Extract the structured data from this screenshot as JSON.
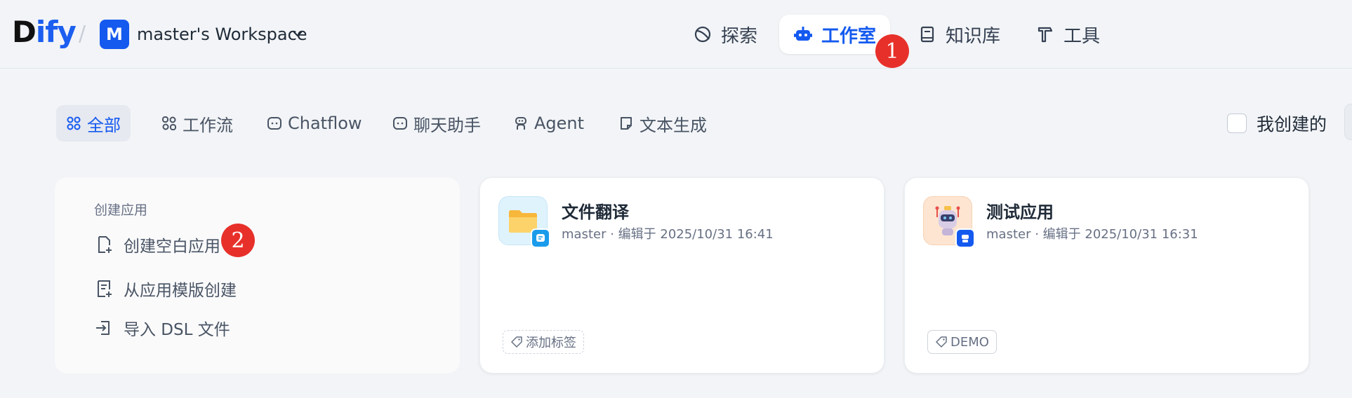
{
  "header": {
    "logo": {
      "part1": "D",
      "part2": "ify"
    },
    "workspace": {
      "initial": "M",
      "name": "master's Workspace"
    },
    "nav": [
      {
        "label": "探索",
        "icon": "explore-icon"
      },
      {
        "label": "工作室",
        "icon": "robot-icon",
        "active": true
      },
      {
        "label": "知识库",
        "icon": "book-icon"
      },
      {
        "label": "工具",
        "icon": "hammer-icon"
      }
    ]
  },
  "annotations": {
    "badge1": "1",
    "badge2": "2"
  },
  "filters": {
    "tabs": [
      {
        "label": "全部",
        "active": true
      },
      {
        "label": "工作流"
      },
      {
        "label": "Chatflow"
      },
      {
        "label": "聊天助手"
      },
      {
        "label": "Agent"
      },
      {
        "label": "文本生成"
      }
    ],
    "mine_label": "我创建的",
    "mine_checked": false
  },
  "create": {
    "title": "创建应用",
    "items": [
      {
        "label": "创建空白应用"
      },
      {
        "label": "从应用模版创建"
      },
      {
        "label": "导入 DSL 文件"
      }
    ]
  },
  "apps": [
    {
      "name": "文件翻译",
      "meta": "master · 编辑于 2025/10/31 16:41",
      "tag": "添加标签",
      "icon": "folder-icon",
      "type": "chatbot"
    },
    {
      "name": "测试应用",
      "meta": "master · 编辑于 2025/10/31 16:31",
      "tag": "DEMO",
      "icon": "robot-icon",
      "type": "agent"
    }
  ],
  "colors": {
    "accent": "#155aef",
    "badge": "#e8302a",
    "background": "#f2f4f7"
  }
}
